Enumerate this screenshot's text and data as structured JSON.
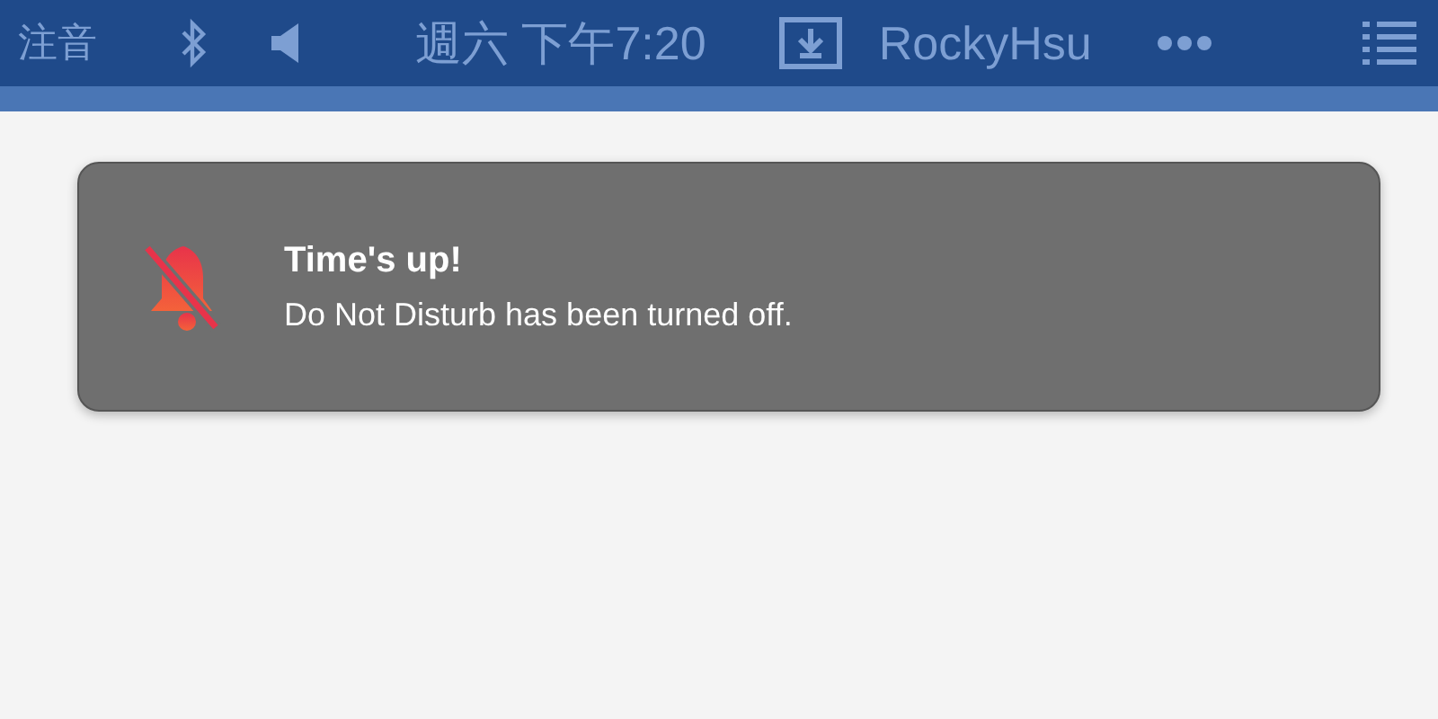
{
  "menu_bar": {
    "input_method": "注音",
    "clock": "週六 下午7:20",
    "user": "RockyHsu"
  },
  "notification": {
    "title": "Time's up!",
    "message": "Do Not Disturb has been turned off."
  }
}
